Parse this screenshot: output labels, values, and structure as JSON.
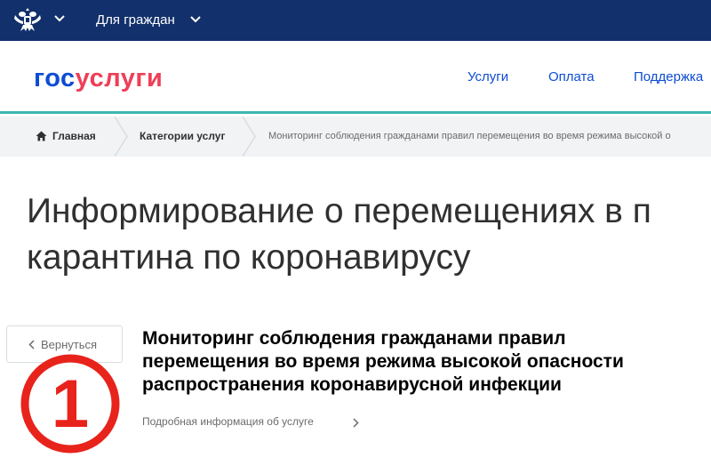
{
  "topbar": {
    "emblem_icon": "russian-coat-of-arms-icon",
    "citizens_label": "Для граждан"
  },
  "header": {
    "logo_part1": "гос",
    "logo_part2": "услуги",
    "nav": [
      "Услуги",
      "Оплата",
      "Поддержка"
    ]
  },
  "breadcrumbs": {
    "home": "Главная",
    "categories": "Категории услуг",
    "current": "Мониторинг соблюдения гражданами правил перемещения во время режима высокой о"
  },
  "page": {
    "title_line1": "Информирование о перемещениях в п",
    "title_line2": "карантина по коронавирусу"
  },
  "back_button": {
    "label": "Вернуться"
  },
  "service": {
    "title_line1": "Мониторинг соблюдения гражданами правил",
    "title_line2": "перемещения во время режима высокой опасности",
    "title_line3": "распространения коронавирусной инфекции",
    "more_label": "Подробная информация об услуге"
  },
  "annotation": {
    "number": "1",
    "color": "#e8231b"
  },
  "colors": {
    "topbar": "#12306b",
    "brand_blue": "#0d4cd3",
    "brand_red": "#ee3f58",
    "accent_teal": "#3bb7b0"
  }
}
